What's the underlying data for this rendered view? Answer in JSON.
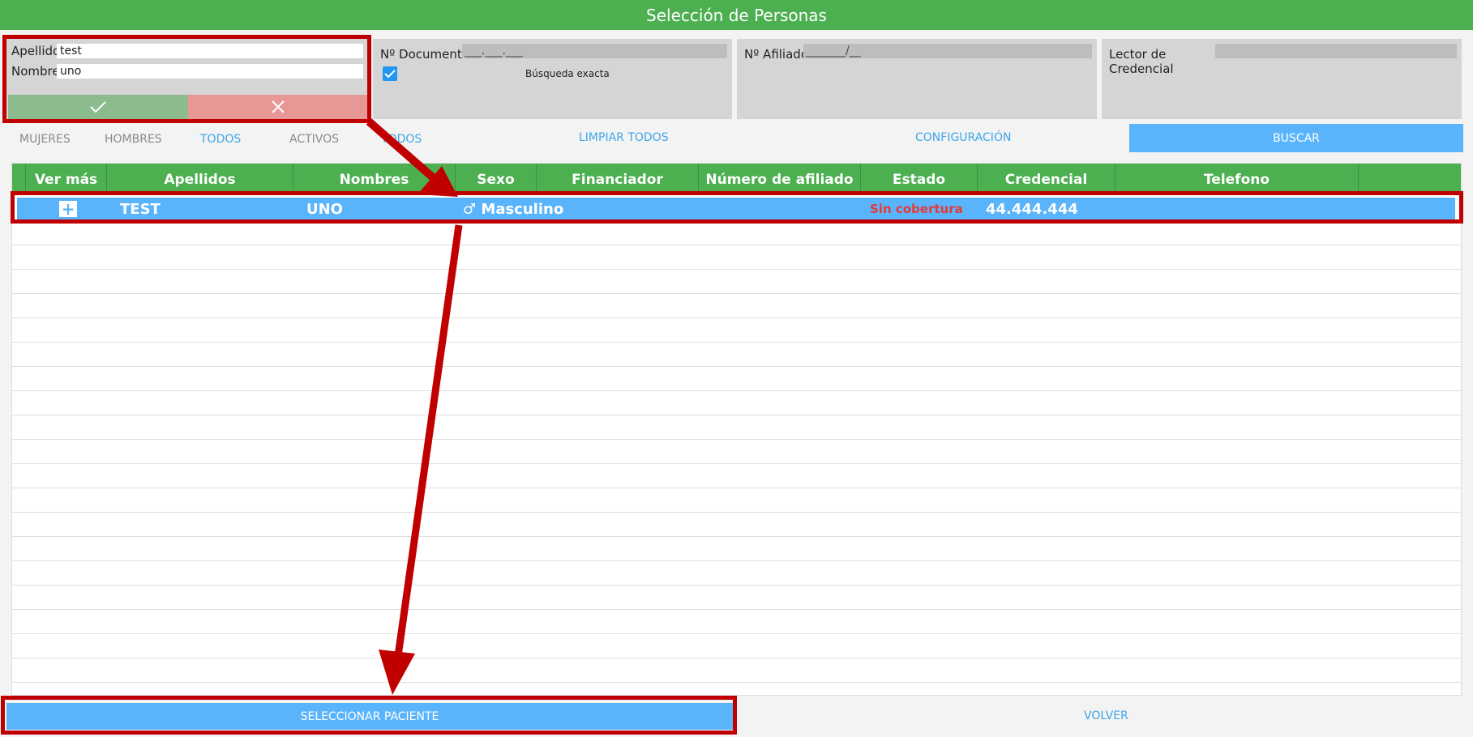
{
  "window": {
    "title": "Selección de Personas"
  },
  "name_search": {
    "apellido_label": "Apellido",
    "apellido_value": "test",
    "nombre_label": "Nombre",
    "nombre_value": "uno"
  },
  "documento": {
    "label": "Nº Documento",
    "mask": "___.___.___",
    "exact_label": "Búsqueda exacta",
    "exact_checked": true
  },
  "afiliado": {
    "label": "Nº Afiliado",
    "mask": "_______/__"
  },
  "lector": {
    "label": "Lector de Credencial"
  },
  "filters": {
    "mujeres": "MUJERES",
    "hombres": "HOMBRES",
    "todos1": "TODOS",
    "activos": "ACTIVOS",
    "todos2": "TODOS"
  },
  "actions": {
    "limpiar": "LIMPIAR TODOS",
    "config": "CONFIGURACIÓN",
    "buscar": "BUSCAR"
  },
  "table": {
    "columns": [
      "Ver más",
      "Apellidos",
      "Nombres",
      "Sexo",
      "Financiador",
      "Número de afiliado",
      "Estado",
      "Credencial",
      "Telefono"
    ],
    "rows": [
      {
        "apellidos": "TEST",
        "nombres": "UNO",
        "sexo": "♂ Masculino",
        "financiador": "",
        "numero_afiliado": "",
        "estado": "Sin cobertura",
        "credencial": "44.444.444",
        "telefono": ""
      }
    ]
  },
  "footer": {
    "seleccionar": "SELECCIONAR PACIENTE",
    "volver": "VOLVER"
  },
  "colors": {
    "green": "#4caf50",
    "blue": "#5ab4fb",
    "annotation_red": "#c00000",
    "status_red": "#e53935"
  }
}
